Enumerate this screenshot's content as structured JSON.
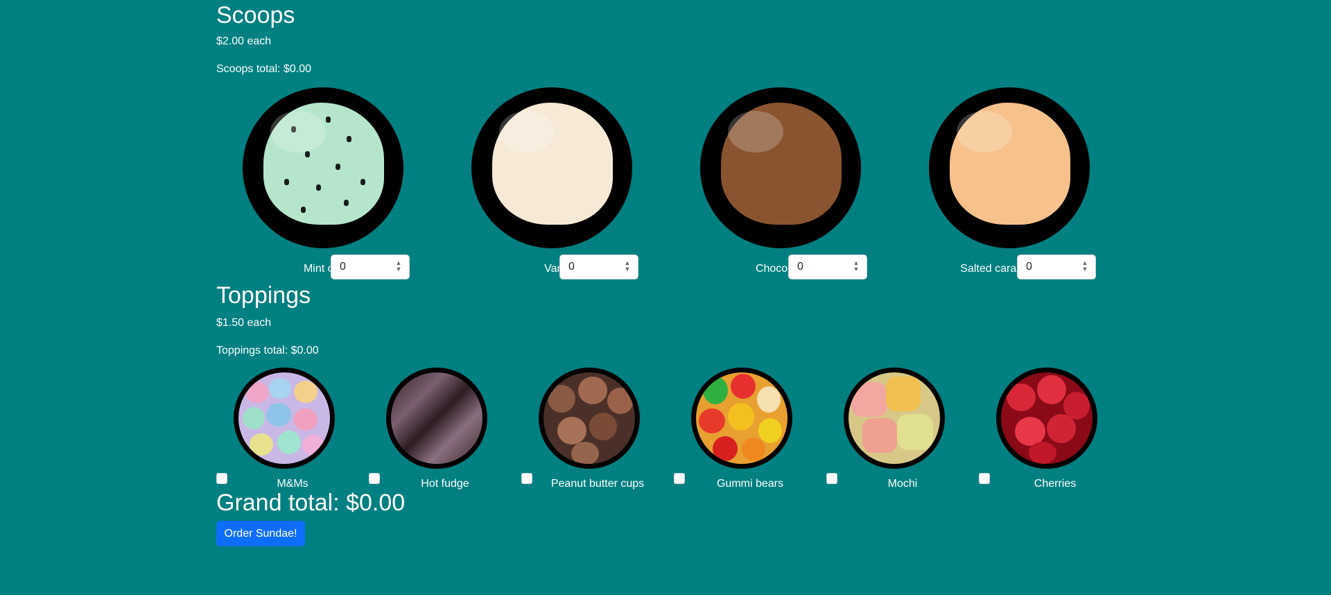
{
  "scoops": {
    "title": "Scoops",
    "price": "$2.00 each",
    "subtotal": "Scoops total: $0.00",
    "items": [
      {
        "label": "Mint chip",
        "quantity": "0",
        "color": "#b5e6cc"
      },
      {
        "label": "Vanilla",
        "quantity": "0",
        "color": "#f6ead6"
      },
      {
        "label": "Chocolate",
        "quantity": "0",
        "color": "#8a5430"
      },
      {
        "label": "Salted caramel",
        "quantity": "0",
        "color": "#f6c18a"
      }
    ]
  },
  "toppings": {
    "title": "Toppings",
    "price": "$1.50 each",
    "subtotal": "Toppings total: $0.00",
    "items": [
      {
        "label": "M&Ms",
        "checked": false
      },
      {
        "label": "Hot fudge",
        "checked": false
      },
      {
        "label": "Peanut butter cups",
        "checked": false
      },
      {
        "label": "Gummi bears",
        "checked": false
      },
      {
        "label": "Mochi",
        "checked": false
      },
      {
        "label": "Cherries",
        "checked": false
      }
    ]
  },
  "grand_total": "Grand total: $0.00",
  "order_button": "Order Sundae!",
  "colors": {
    "background": "#008080",
    "button": "#0d6efd"
  }
}
